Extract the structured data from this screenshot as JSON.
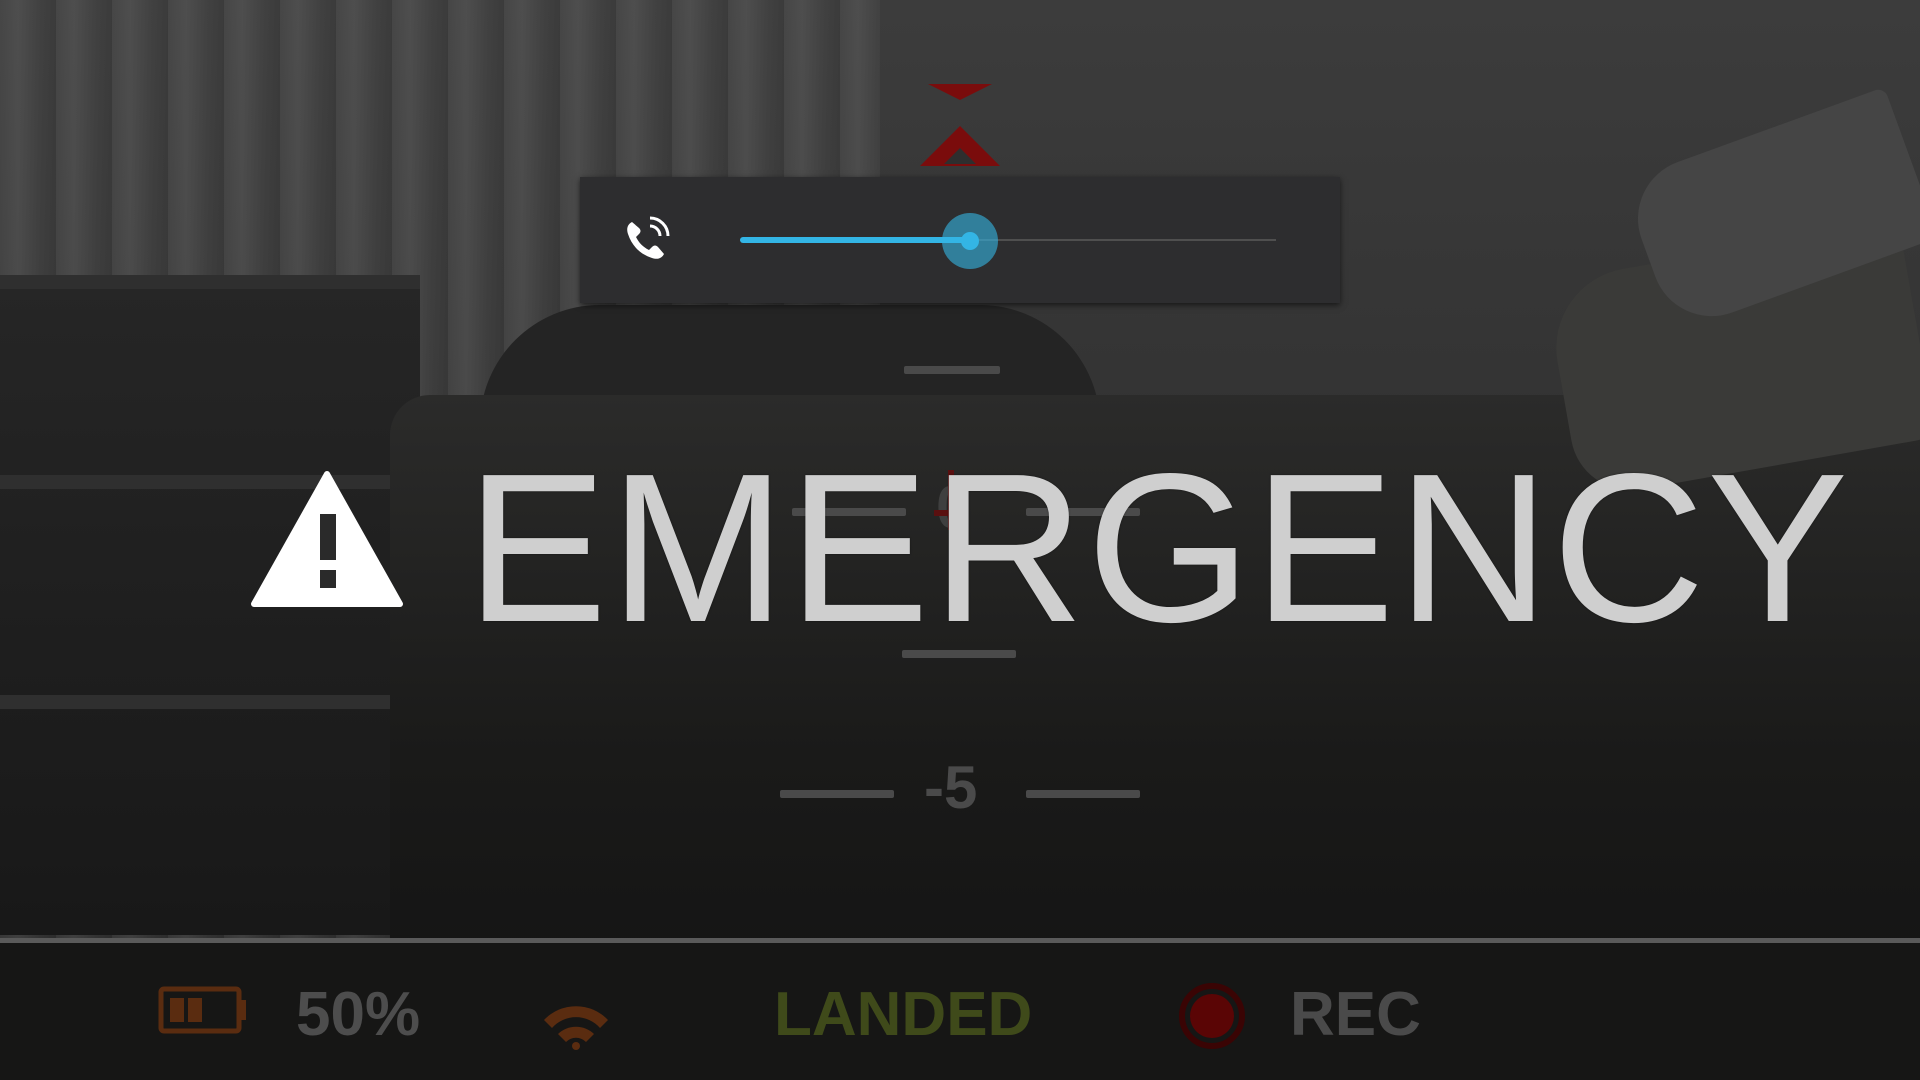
{
  "volume": {
    "stream_icon": "phone-in-call-icon",
    "level_fraction": 0.43,
    "accent_color": "#33b5e5"
  },
  "hud": {
    "pitch_labels": [
      "0",
      "-5"
    ]
  },
  "alert": {
    "icon": "warning-triangle-icon",
    "title": "EMERGENCY"
  },
  "status_bar": {
    "battery": {
      "icon": "battery-icon",
      "percent_text": "50%",
      "color": "#5a2c10"
    },
    "wifi": {
      "icon": "wifi-icon",
      "color": "#5a2c10"
    },
    "flight_state": "LANDED",
    "flight_state_color": "#3f4a1a",
    "record": {
      "icon": "record-icon",
      "label": "REC",
      "color": "#5a0505"
    }
  }
}
